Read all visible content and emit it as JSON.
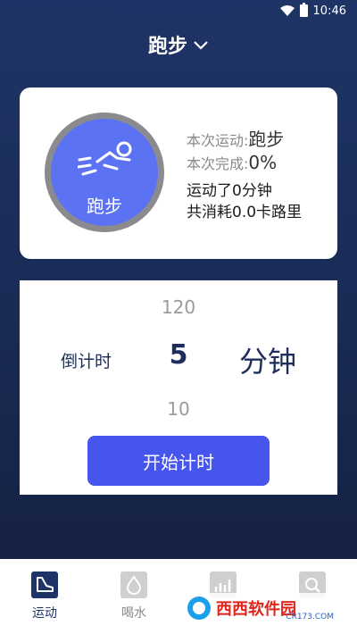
{
  "status_bar": {
    "time": "10:46"
  },
  "header": {
    "title": "跑步"
  },
  "summary_card": {
    "circle_label": "跑步",
    "rows": [
      {
        "label": "本次运动:",
        "value": "跑步"
      },
      {
        "label": "本次完成:",
        "value": "0%"
      }
    ],
    "duration_text": "运动了0分钟",
    "calories_text": "共消耗0.0卡路里"
  },
  "timer_card": {
    "countdown_label": "倒计时",
    "picker_above": "120",
    "picker_value": "5",
    "picker_below": "10",
    "unit": "分钟",
    "start_button": "开始计时"
  },
  "tabbar": {
    "tabs": [
      {
        "label": "运动",
        "icon": "shoe-icon",
        "active": true
      },
      {
        "label": "喝水",
        "icon": "water-drop-icon",
        "active": false
      },
      {
        "label": "",
        "icon": "chart-icon",
        "active": false
      },
      {
        "label": "",
        "icon": "search-icon",
        "active": false
      }
    ]
  },
  "watermark": {
    "text": "西西软件园",
    "sub": "CR173.COM"
  },
  "colors": {
    "accent": "#4655ec",
    "circle": "#5b73f2",
    "header_bg": "#1f3466"
  }
}
